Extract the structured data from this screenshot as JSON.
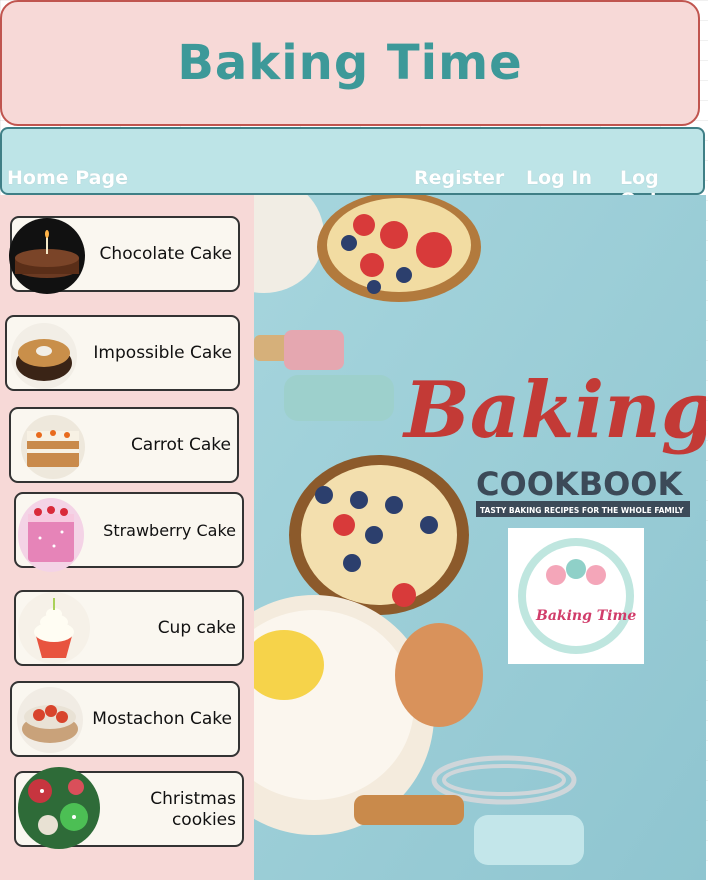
{
  "header": {
    "title": "Baking Time"
  },
  "nav": {
    "home": "Home Page",
    "register": "Register",
    "login": "Log In",
    "logout": "Log Out"
  },
  "sidebar": {
    "items": [
      {
        "label": "Chocolate Cake",
        "icon": "chocolate-cake"
      },
      {
        "label": "Impossible Cake",
        "icon": "impossible-cake"
      },
      {
        "label": "Carrot Cake",
        "icon": "carrot-cake"
      },
      {
        "label": "Strawberry Cake",
        "icon": "strawberry-cake"
      },
      {
        "label": "Cup cake",
        "icon": "cupcake"
      },
      {
        "label": "Mostachon Cake",
        "icon": "mostachon-cake"
      },
      {
        "label": "Christmas",
        "label2": "cookies",
        "icon": "christmas-cookies"
      }
    ]
  },
  "hero": {
    "script_title": "Baking",
    "cookbook_title": "COOKBOOK",
    "tagline": "TASTY BAKING RECIPES FOR THE WHOLE FAMILY",
    "badge_text": "Baking Time"
  },
  "colors": {
    "header_bg": "#f7d9d7",
    "header_border": "#c0554f",
    "title_color": "#3d9999",
    "nav_bg": "#bde4e7",
    "sidebar_bg": "#f7d9d7",
    "card_bg": "#faf7f0"
  }
}
